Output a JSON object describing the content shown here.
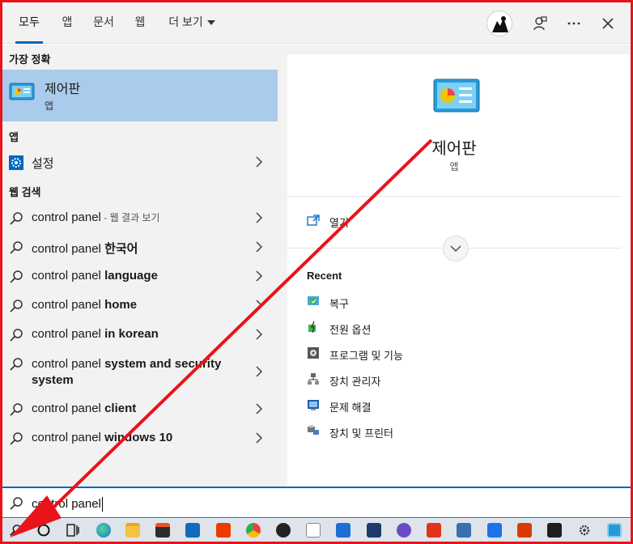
{
  "tabs": [
    {
      "label": "모두"
    },
    {
      "label": "앱"
    },
    {
      "label": "문서"
    },
    {
      "label": "웹"
    },
    {
      "label": "더 보기"
    }
  ],
  "left": {
    "best_match_title": "가장 정확",
    "best_match": {
      "name": "제어판",
      "type": "앱"
    },
    "apps_title": "앱",
    "apps": [
      {
        "label": "설정"
      }
    ],
    "web_title": "웹 검색",
    "web_results": [
      {
        "query": "control panel",
        "suffix": " - 웹 결과 보기"
      },
      {
        "query": "control panel ",
        "bold": "한국어"
      },
      {
        "query": "control panel ",
        "bold": "language"
      },
      {
        "query": "control panel ",
        "bold": "home"
      },
      {
        "query": "control panel ",
        "bold": "in korean"
      },
      {
        "query": "control panel ",
        "bold": "system and security",
        "line2": "system"
      },
      {
        "query": "control panel ",
        "bold": "client"
      },
      {
        "query": "control panel ",
        "bold": "windows 10"
      }
    ]
  },
  "detail": {
    "title": "제어판",
    "type": "앱",
    "open_label": "열기",
    "recent_title": "Recent",
    "recent": [
      {
        "label": "복구",
        "icon": "recovery-icon"
      },
      {
        "label": "전원 옵션",
        "icon": "power-options-icon"
      },
      {
        "label": "프로그램 및 기능",
        "icon": "programs-features-icon"
      },
      {
        "label": "장치 관리자",
        "icon": "device-manager-icon"
      },
      {
        "label": "문제 해결",
        "icon": "troubleshoot-icon"
      },
      {
        "label": "장치 및 프린터",
        "icon": "devices-printers-icon"
      }
    ]
  },
  "search": {
    "value": "control panel"
  },
  "colors": {
    "accent": "#0067c0",
    "highlight": "#aacbeb",
    "annotation": "#e8141b"
  }
}
